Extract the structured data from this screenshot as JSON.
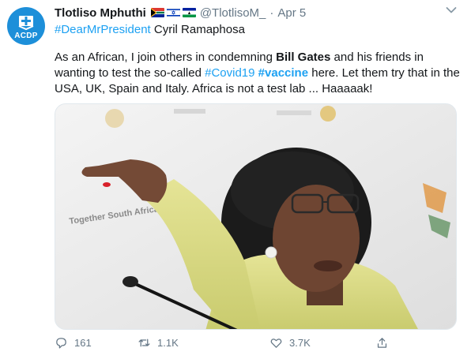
{
  "tweet": {
    "author": {
      "display_name": "Tlotliso Mphuthi",
      "handle": "@TlotlisoM_",
      "avatar_text": "ACDP",
      "flags": [
        "south-africa-flag",
        "israel-flag",
        "lesotho-flag"
      ]
    },
    "separator": "·",
    "timestamp": "Apr 5",
    "mention_line": {
      "hashtag": "#DearMrPresident",
      "rest": " Cyril Ramaphosa"
    },
    "body": {
      "p1": "As an African, I join others in condemning ",
      "bold1": "Bill Gates",
      "p2": " and his friends in wanting to test the so-called ",
      "tag1": "#Covid19",
      "p3": " ",
      "tag2": "#vaccine",
      "p4": " here. Let them try that in the USA, UK, Spain and Italy. Africa is not a test lab ... Haaaaak!"
    },
    "media": {
      "type": "photo",
      "background_text": "Together South Africa"
    },
    "actions": {
      "reply_count": "161",
      "retweet_count": "1.1K",
      "like_count": "3.7K"
    },
    "colors": {
      "link": "#1da1f2",
      "secondary_text": "#657786",
      "avatar_bg": "#1d8fd9"
    }
  }
}
